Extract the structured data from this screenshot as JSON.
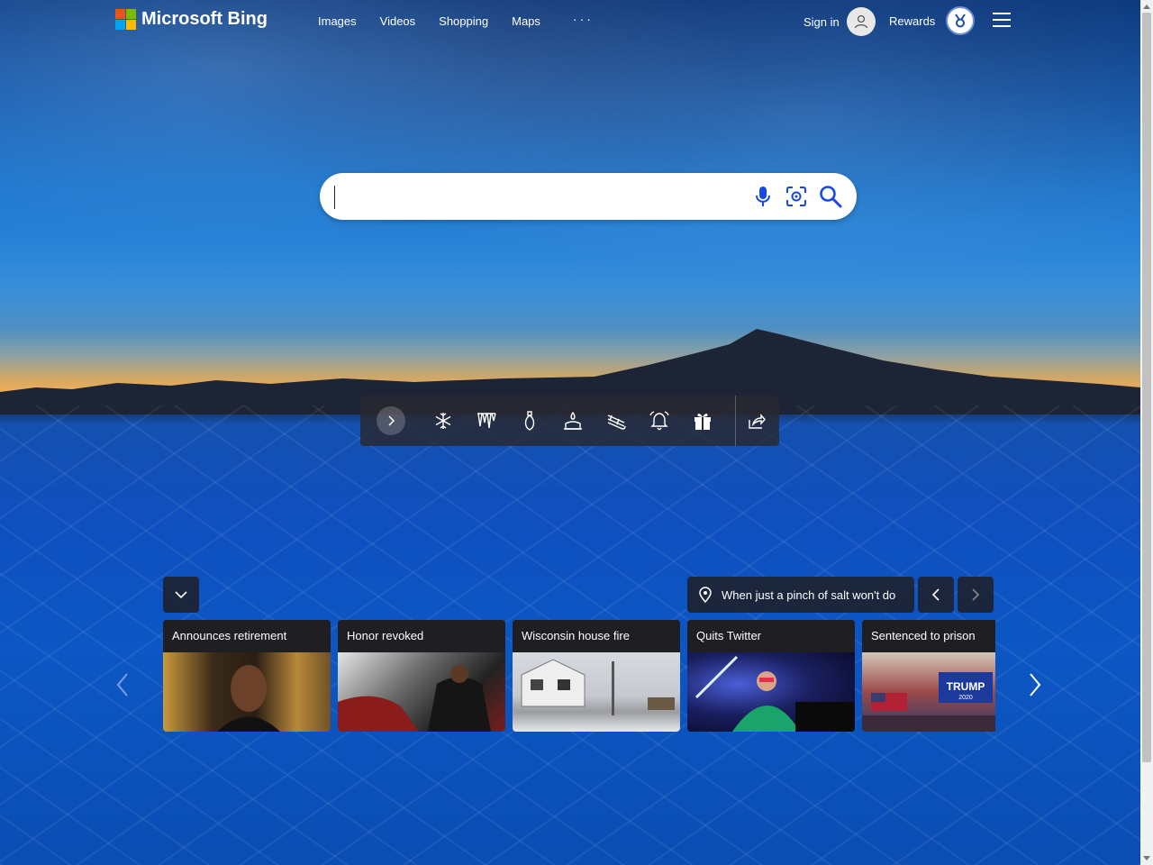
{
  "header": {
    "logo_text": "Microsoft Bing",
    "nav": [
      "Images",
      "Videos",
      "Shopping",
      "Maps"
    ],
    "more_label": "···",
    "signin_label": "Sign in",
    "rewards_label": "Rewards"
  },
  "search": {
    "value": "",
    "placeholder": ""
  },
  "toolbar": {
    "icons": [
      "chevron-right-icon",
      "snowflake-icon",
      "icicles-icon",
      "christmas-light-icon",
      "candle-icon",
      "sled-icon",
      "bell-icon",
      "gift-icon",
      "share-icon"
    ]
  },
  "image_info": {
    "caption": "When just a pinch of salt won't do"
  },
  "news": [
    {
      "title": "Announces retirement"
    },
    {
      "title": "Honor revoked"
    },
    {
      "title": "Wisconsin house fire"
    },
    {
      "title": "Quits Twitter"
    },
    {
      "title": "Sentenced to prison"
    }
  ],
  "colors": {
    "ms_red": "#f25022",
    "ms_green": "#7fba00",
    "ms_blue": "#00a4ef",
    "ms_yellow": "#ffb900",
    "icon_teal": "#106ebe"
  }
}
